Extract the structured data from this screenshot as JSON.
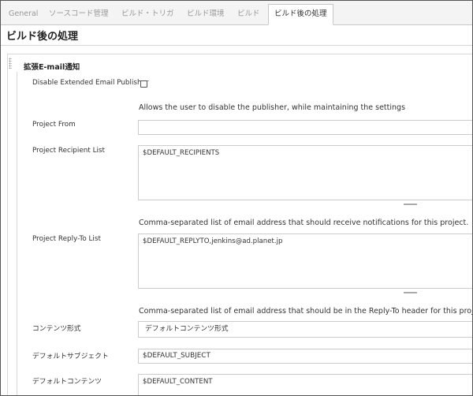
{
  "tabs": [
    {
      "label": "General",
      "active": false
    },
    {
      "label": "ソースコード管理",
      "active": false
    },
    {
      "label": "ビルド・トリガ",
      "active": false
    },
    {
      "label": "ビルド環境",
      "active": false
    },
    {
      "label": "ビルド",
      "active": false
    },
    {
      "label": "ビルド後の処理",
      "active": true
    }
  ],
  "section": {
    "title": "ビルド後の処理"
  },
  "block": {
    "title": "拡張E-mail通知"
  },
  "fields": {
    "disable_publisher": {
      "label": "Disable Extended Email Publisher",
      "checked": false,
      "help": "Allows the user to disable the publisher, while maintaining the settings"
    },
    "project_from": {
      "label": "Project From",
      "value": ""
    },
    "recipient_list": {
      "label": "Project Recipient List",
      "value": "$DEFAULT_RECIPIENTS",
      "help": "Comma-separated list of email address that should receive notifications for this project."
    },
    "reply_to_list": {
      "label": "Project Reply-To List",
      "value": "$DEFAULT_REPLYTO,jenkins@ad.planet.jp",
      "help": "Comma-separated list of email address that should be in the Reply-To header for this project."
    },
    "content_type": {
      "label": "コンテンツ形式",
      "value": "デフォルトコンテンツ形式"
    },
    "default_subject": {
      "label": "デフォルトサブジェクト",
      "value": "$DEFAULT_SUBJECT"
    },
    "default_content": {
      "label": "デフォルトコンテンツ",
      "value": "$DEFAULT_CONTENT"
    }
  }
}
